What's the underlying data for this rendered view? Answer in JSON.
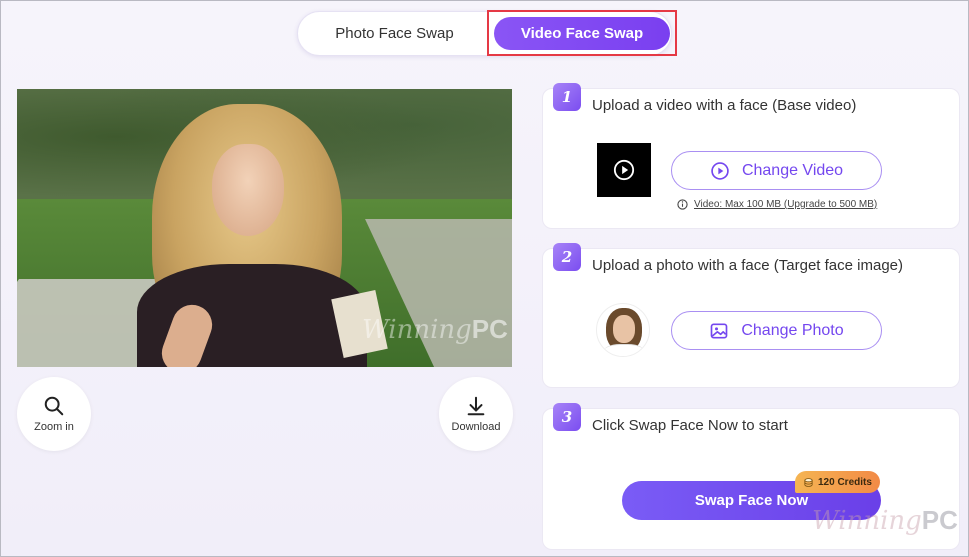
{
  "tabs": {
    "photo_label": "Photo Face Swap",
    "video_label": "Video Face Swap",
    "active": "Video Face Swap"
  },
  "preview": {
    "watermark_script": "Winning",
    "watermark_bold": "PC"
  },
  "tools": {
    "zoom_label": "Zoom in",
    "download_label": "Download"
  },
  "steps": [
    {
      "number": "1",
      "title": "Upload a video with a face (Base video)",
      "button_label": "Change Video",
      "note": "Video: Max 100 MB (Upgrade to 500 MB)"
    },
    {
      "number": "2",
      "title": "Upload a photo with a face (Target face image)",
      "button_label": "Change Photo"
    },
    {
      "number": "3",
      "title": "Click Swap Face Now to start",
      "button_label": "Swap Face Now",
      "credits": "120 Credits"
    }
  ],
  "colors": {
    "accent": "#7447ef",
    "highlight": "#e53945",
    "credits": "#f5b553"
  },
  "icons": [
    "play-icon",
    "image-icon",
    "info-icon",
    "search-icon",
    "download-icon",
    "coin-icon"
  ]
}
